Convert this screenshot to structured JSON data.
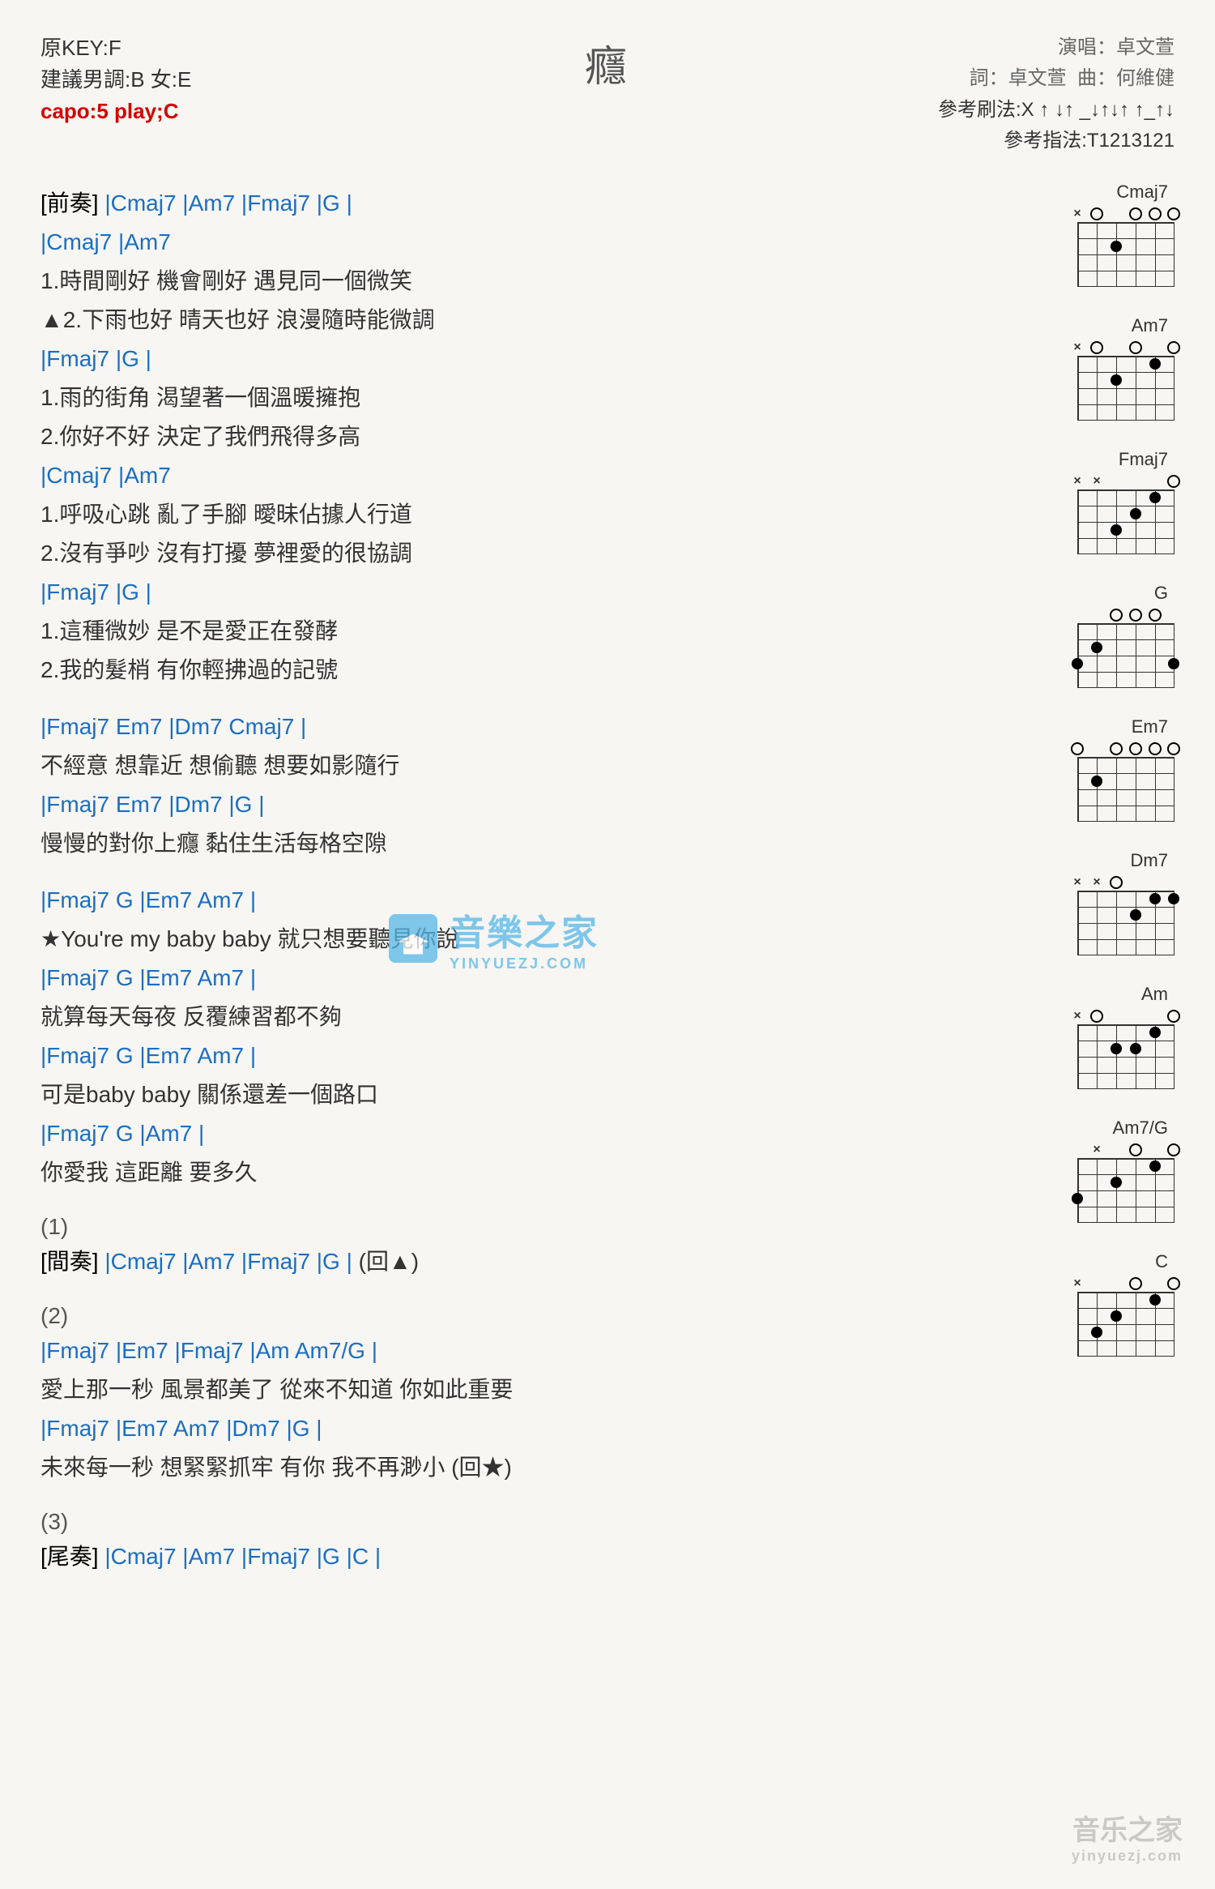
{
  "header": {
    "key": "原KEY:F",
    "suggest": "建議男調:B 女:E",
    "capo": "capo:5 play;C",
    "title": "癮",
    "singer_lbl": "演唱：",
    "singer": "卓文萱",
    "lyric_lbl": "詞：",
    "lyricist": "卓文萱",
    "comp_lbl": "曲：",
    "composer": "何維健",
    "strum": "參考刷法:X ↑ ↓↑ _↓↑↓↑ ↑_↑↓",
    "finger": "參考指法:T1213121"
  },
  "intro": {
    "label": "[前奏]",
    "chords": "|Cmaj7    |Am7    |Fmaj7    |G    |"
  },
  "v1": {
    "c1": "|Cmaj7                           |Am7",
    "l1a": "  1.時間剛好    機會剛好    遇見同一個微笑",
    "l1b": "▲2.下雨也好    晴天也好    浪漫隨時能微調",
    "c2": "|Fmaj7                      |G                          |",
    "l2a": "  1.雨的街角    渴望著一個溫暖擁抱",
    "l2b": "  2.你好不好    決定了我們飛得多高",
    "c3": "|Cmaj7                           |Am7",
    "l3a": "  1.呼吸心跳    亂了手腳    曖昧佔據人行道",
    "l3b": "  2.沒有爭吵    沒有打擾    夢裡愛的很協調",
    "c4": "|Fmaj7                      |G                          |",
    "l4a": "  1.這種微妙    是不是愛正在發酵",
    "l4b": "  2.我的髮梢    有你輕拂過的記號"
  },
  "pre": {
    "c1": "              |Fmaj7     Em7       |Dm7     Cmaj7       |",
    "l1": "不經意    想靠近    想偷聽    想要如影隨行",
    "c2": "|Fmaj7   Em7     |Dm7                       |G     |",
    "l2": "慢慢的對你上癮    黏住生活每格空隙"
  },
  "chorus": {
    "c1": "                |Fmaj7           G       |Em7    Am7      |",
    "l1": "★You're my baby baby    就只想要聽見你說",
    "c2": "       |Fmaj7       G       |Em7    Am7      |",
    "l2": "就算每天每夜    反覆練習都不夠",
    "c3": "           |Fmaj7             G          |Em7    Am7      |",
    "l3": "可是baby    baby    關係還差一個路口",
    "c4": "        |Fmaj7      G         |Am7      |",
    "l4": "你愛我    這距離    要多久"
  },
  "s1": {
    "n": "(1)",
    "label": "[間奏]",
    "chords": "|Cmaj7    |Am7    |Fmaj7    |G    |",
    "back": "(回▲)"
  },
  "s2": {
    "n": "(2)",
    "c1": "       |Fmaj7          |Em7          |Fmaj7             |Am    Am7/G    |",
    "l1": "愛上那一秒    風景都美了    從來不知道    你如此重要",
    "c2": "       |Fmaj7          |Em7    Am7    |Dm7              |G    |",
    "l2": "未來每一秒    想緊緊抓牢    有你    我不再渺小        (回★)"
  },
  "s3": {
    "n": "(3)",
    "label": "[尾奏]",
    "chords": "|Cmaj7    |Am7    |Fmaj7    |G    |C    |"
  },
  "diagrams": [
    "Cmaj7",
    "Am7",
    "Fmaj7",
    "G",
    "Em7",
    "Dm7",
    "Am",
    "Am7/G",
    "C"
  ],
  "watermark": {
    "main": "音樂之家",
    "sub": "YINYUEZJ.COM"
  },
  "footer_wm": {
    "main": "音乐之家",
    "sub": "yinyuezj.com"
  }
}
